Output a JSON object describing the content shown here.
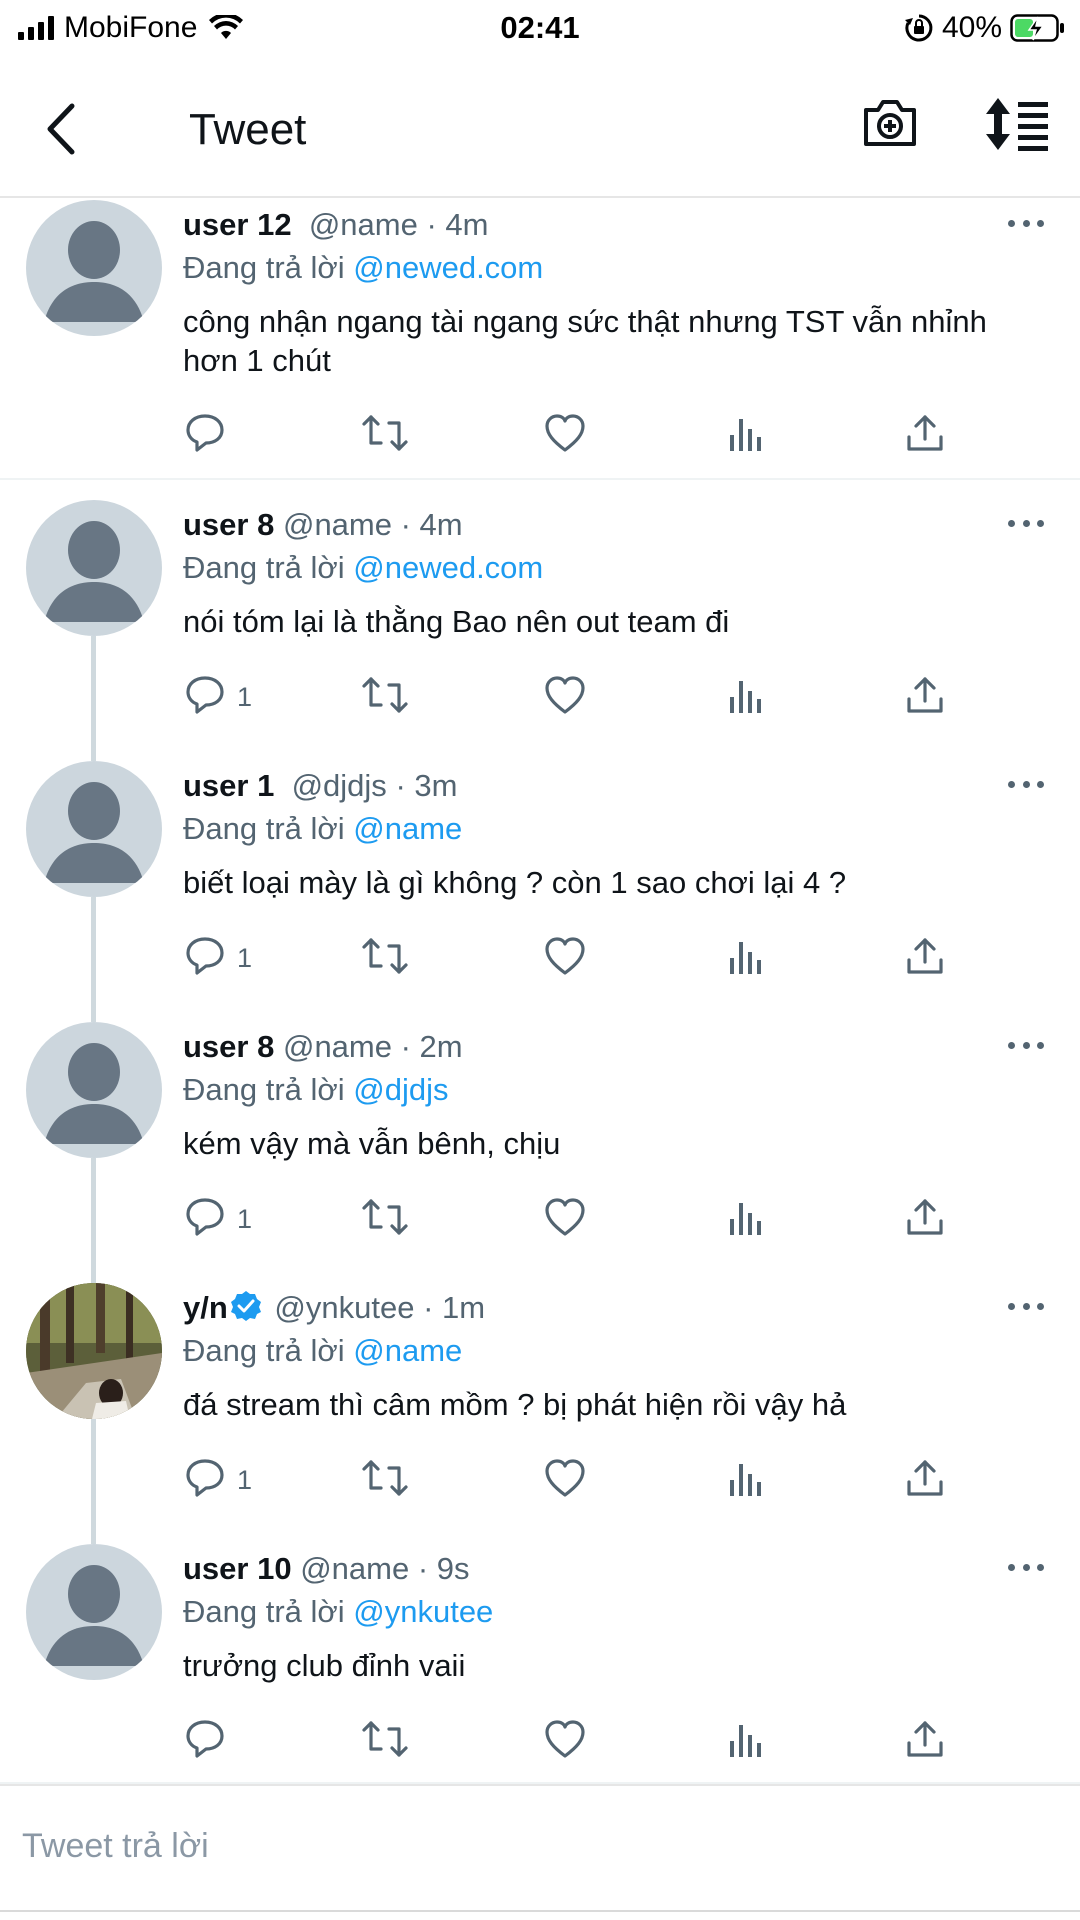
{
  "status_bar": {
    "carrier": "MobiFone",
    "time": "02:41",
    "battery": "40%"
  },
  "header": {
    "title": "Tweet"
  },
  "tweets": [
    {
      "user": "user 12",
      "handle": "@name",
      "time": "· 4m",
      "reply_prefix": "Đang trả lời",
      "reply_to": "@newed.com",
      "text": "công nhận ngang tài ngang sức thật nhưng TST vẫn nhỉnh hơn 1 chút",
      "reply_count": ""
    },
    {
      "user": "user 8",
      "handle": "@name",
      "time": "· 4m",
      "reply_prefix": "Đang trả lời",
      "reply_to": "@newed.com",
      "text": "nói tóm lại là thằng Bao nên out team đi",
      "reply_count": "1"
    },
    {
      "user": "user 1",
      "handle": "@djdjs",
      "time": "· 3m",
      "reply_prefix": "Đang trả lời",
      "reply_to": "@name",
      "text": "biết loại mày là gì không ? còn 1 sao chơi lại 4 ?",
      "reply_count": "1"
    },
    {
      "user": "user 8",
      "handle": "@name",
      "time": "· 2m",
      "reply_prefix": "Đang trả lời",
      "reply_to": "@djdjs",
      "text": "kém vậy mà vẫn bênh, chịu",
      "reply_count": "1"
    },
    {
      "user": "y/n",
      "handle": "@ynkutee",
      "time": "· 1m",
      "verified": true,
      "reply_prefix": "Đang trả lời",
      "reply_to": "@name",
      "text": "đá stream thì câm mồm ? bị phát hiện rồi vậy hả",
      "reply_count": "1"
    },
    {
      "user": "user 10",
      "handle": "@name",
      "time": "· 9s",
      "reply_prefix": "Đang trả lời",
      "reply_to": "@ynkutee",
      "text": "trưởng club đỉnh vaii",
      "reply_count": ""
    }
  ],
  "reply_box": {
    "placeholder": "Tweet trả lời"
  },
  "colors": {
    "accent": "#1d9bf0",
    "muted": "#536471",
    "avatar_bg": "#ccd6dd",
    "avatar_fg": "#687684"
  },
  "icons": {
    "reply": "reply-icon",
    "retweet": "retweet-icon",
    "like": "heart-icon",
    "analytics": "analytics-icon",
    "share": "share-icon"
  }
}
